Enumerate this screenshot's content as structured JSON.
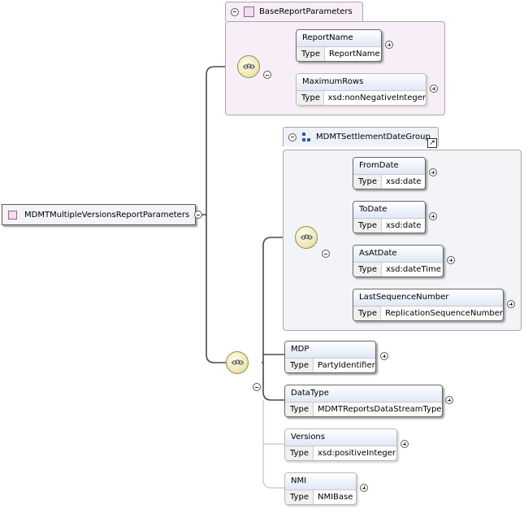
{
  "root": {
    "name": "MDMTMultipleVersionsReportParameters"
  },
  "attribute_group": {
    "name": "BaseReportParameters",
    "elements": [
      {
        "name": "ReportName",
        "type_label": "Type",
        "type": "ReportName"
      },
      {
        "name": "MaximumRows",
        "type_label": "Type",
        "type": "xsd:nonNegativeInteger"
      }
    ]
  },
  "element_group": {
    "name": "MDMTSettlementDateGroup",
    "elements": [
      {
        "name": "FromDate",
        "type_label": "Type",
        "type": "xsd:date"
      },
      {
        "name": "ToDate",
        "type_label": "Type",
        "type": "xsd:date"
      },
      {
        "name": "AsAtDate",
        "type_label": "Type",
        "type": "xsd:dateTime"
      },
      {
        "name": "LastSequenceNumber",
        "type_label": "Type",
        "type": "ReplicationSequenceNumber"
      }
    ]
  },
  "sequence_elements": [
    {
      "name": "MDP",
      "type_label": "Type",
      "type": "PartyIdentifier"
    },
    {
      "name": "DataType",
      "type_label": "Type",
      "type": "MDMTReportsDataStreamType"
    },
    {
      "name": "Versions",
      "type_label": "Type",
      "type": "xsd:positiveInteger"
    },
    {
      "name": "NMI",
      "type_label": "Type",
      "type": "NMIBase"
    }
  ],
  "icons": {
    "compositor": "sequence-compositor-icon",
    "collapse": "collapse-minus-icon",
    "expand": "expand-plus-icon",
    "attribute_group": "attribute-group-icon",
    "element_group": "group-icon",
    "reference": "reference-arrow-icon"
  },
  "colors": {
    "attribute_group_background": "#f7eef7",
    "group_background": "#f2f4f8",
    "element_header_gradient_end": "#dfe8f7",
    "compositor_fill": "#f1e8b8"
  }
}
